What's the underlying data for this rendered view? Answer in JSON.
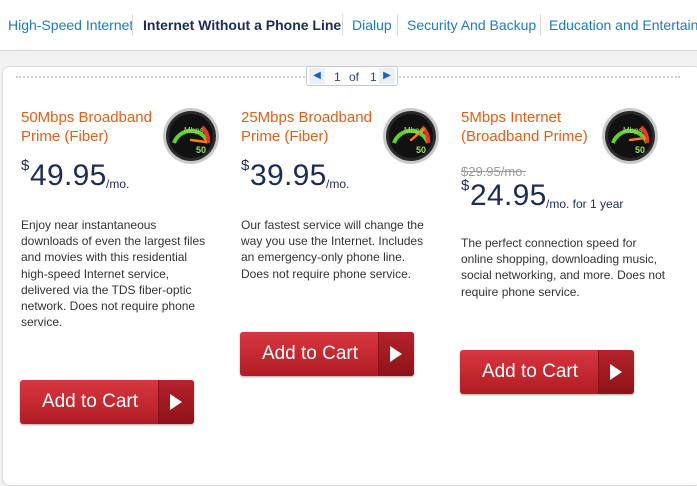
{
  "tabs": [
    {
      "label": "High-Speed Internet",
      "active": false
    },
    {
      "label": "Internet Without a Phone Line",
      "active": true
    },
    {
      "label": "Dialup",
      "active": false
    },
    {
      "label": "Security And Backup",
      "active": false
    },
    {
      "label": "Education and Entertainment",
      "active": false
    }
  ],
  "pager": {
    "current": "1",
    "of": "of",
    "total": "1",
    "prev_icon": "triangle-left",
    "next_icon": "triangle-right"
  },
  "products": [
    {
      "name": "50Mbps Broadband Prime (Fiber)",
      "gauge_label": "Mbps",
      "gauge_value": "50",
      "price_symbol": "$",
      "price": "49.95",
      "price_unit": "/mo.",
      "old_price": "",
      "description": "Enjoy near instantaneous downloads of even the largest files and movies with this residential high-speed Internet service, delivered via the TDS fiber-optic network. Does not require phone service.",
      "cart_label": "Add to Cart"
    },
    {
      "name": "25Mbps Broadband Prime (Fiber)",
      "gauge_label": "Mbps",
      "gauge_value": "50",
      "price_symbol": "$",
      "price": "39.95",
      "price_unit": "/mo.",
      "old_price": "",
      "description": "Our fastest service will change the way you use the Internet. Includes an emergency-only phone line. Does not require phone service.",
      "cart_label": "Add to Cart"
    },
    {
      "name": "5Mbps Internet (Broadband Prime)",
      "gauge_label": "Mbps",
      "gauge_value": "50",
      "price_symbol": "$",
      "price": "24.95",
      "price_unit": "/mo. for 1 year",
      "old_price": "$29.95/mo.",
      "description": "The perfect connection speed for online shopping, downloading music, social networking, and more. Does not require phone service.",
      "cart_label": "Add to Cart"
    }
  ],
  "colors": {
    "tab_link": "#1f7bbf",
    "tab_active": "#1d2b56",
    "product_name": "#e0601a",
    "price": "#1d2b56",
    "button": "#c4262e"
  }
}
